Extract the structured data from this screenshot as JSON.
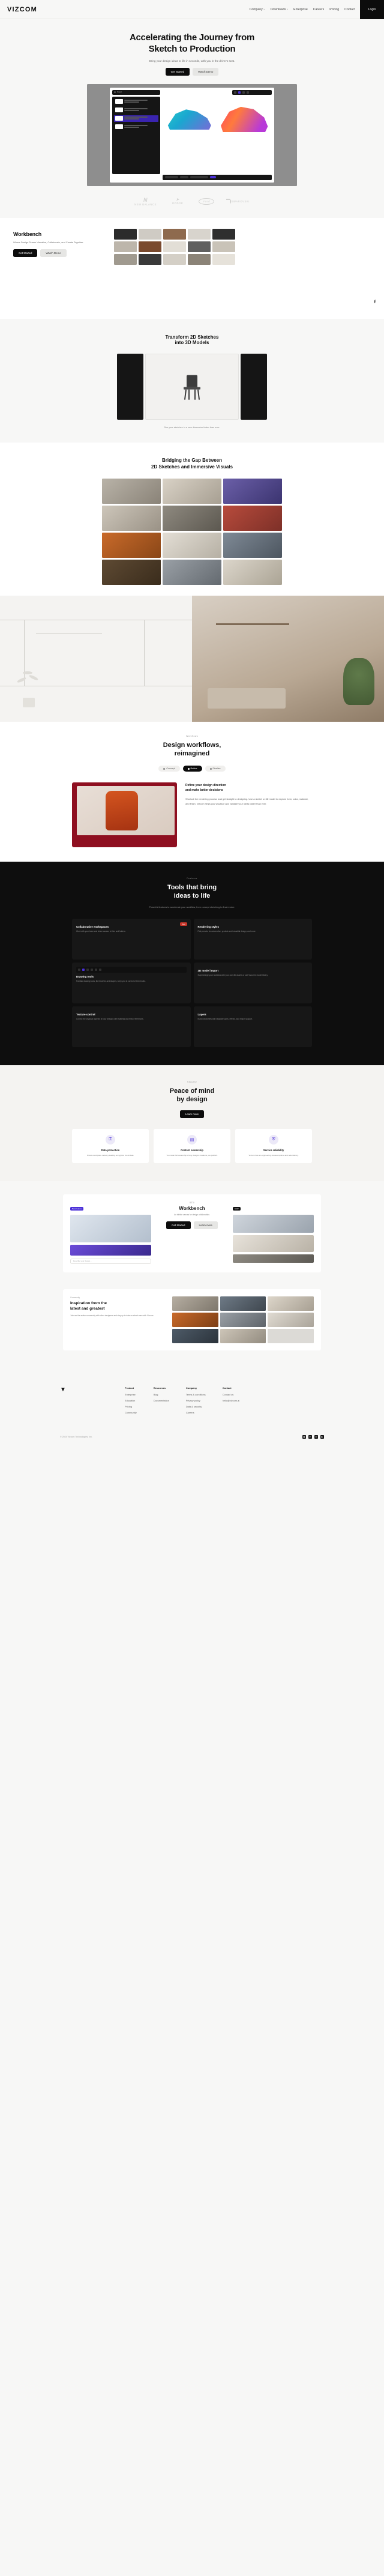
{
  "brand": {
    "name": "VIZCOM"
  },
  "header": {
    "nav": [
      {
        "label": "Company",
        "caret": "˅"
      },
      {
        "label": "Downloads",
        "caret": "˅"
      },
      {
        "label": "Enterprise",
        "caret": ""
      },
      {
        "label": "Careers",
        "caret": ""
      },
      {
        "label": "Pricing",
        "caret": ""
      },
      {
        "label": "Contact",
        "caret": ""
      }
    ],
    "login_label": "Login"
  },
  "hero": {
    "title_line1": "Accelerating the Journey from",
    "title_line2": "Sketch to Production",
    "subtitle": "Bring your design ideas to life in seconds, with you in the driver's seat.",
    "primary_cta": "Get Started",
    "secondary_cta": "Watch Demo",
    "app": {
      "topbar_label": "Project",
      "layers_label": "Layers",
      "layers": [
        {
          "title": "Sketch",
          "sub": "Base layer"
        },
        {
          "title": "Color blocking",
          "sub": "Overlay"
        },
        {
          "title": "Render pass",
          "sub": "Selected"
        },
        {
          "title": "Background",
          "sub": "Locked"
        }
      ]
    }
  },
  "logos": [
    {
      "name": "new-balance",
      "glyph": "N",
      "label": "NEW BALANCE"
    },
    {
      "name": "dodge",
      "glyph": "➤",
      "label": "DODGE"
    },
    {
      "name": "ford",
      "glyph": "Ford",
      "label": ""
    },
    {
      "name": "swarovski",
      "glyph": "",
      "label": "SWAROVSKI"
    }
  ],
  "workbench": {
    "title": "Workbench",
    "body": "Where Design Teams Visualize, Collaborate, and Create Together.",
    "primary_cta": "Get Started",
    "secondary_cta": "Watch Demo",
    "social_icon": "facebook-icon"
  },
  "transform3d": {
    "title_line1": "Transform 2D Sketches",
    "title_line2": "into 3D Models",
    "caption": "See your sketches in a new dimension faster than ever."
  },
  "bridge": {
    "title_line1": "Bridging the Gap Between",
    "title_line2": "2D Sketches and Immersive Visuals"
  },
  "workflows": {
    "eyebrow": "Workflows",
    "title_line1": "Design workflows,",
    "title_line2": "reimagined",
    "tabs": [
      {
        "label": "Concept",
        "active": false
      },
      {
        "label": "Refine",
        "active": true
      },
      {
        "label": "Finalize",
        "active": false
      }
    ],
    "card_title_line1": "Refine your design direction",
    "card_title_line2": "and make better decisions",
    "card_body": "Shortcut the rendering process and get straight to designing. Use a sketch or 3D model to explore form, color, material, and finish. Vizcom helps you visualize and validate your ideas faster than ever."
  },
  "tools": {
    "eyebrow": "Features",
    "title_line1": "Tools that bring",
    "title_line2": "ideas to life",
    "subtitle": "Powerful features to accelerate your workflow, from concept sketching to final render.",
    "cards": [
      {
        "name": "collaborative-workspaces",
        "title": "Collaborative workspaces",
        "body": "Work with your team and share access to files and folders.",
        "badge": "New",
        "art": "purple"
      },
      {
        "name": "rendering-styles",
        "title": "Rendering styles",
        "body": "Pick presets for automotive, product and industrial design, and more.",
        "badge": "",
        "art": "grey"
      },
      {
        "name": "drawing-tools",
        "title": "Drawing tools",
        "body": "Familiar drawing tools, like brushes and shapes, keep you in control of the results.",
        "badge": "",
        "art": "tools"
      },
      {
        "name": "3d-model-import",
        "title": "3D model import",
        "body": "Supercharge your workflow with your own 3D assets or use Vizcom's model library.",
        "badge": "",
        "art": "carblue"
      },
      {
        "name": "texture-control",
        "title": "Texture control",
        "body": "Control the physical aspects of your designs with material and finish references.",
        "badge": "",
        "art": "skin"
      },
      {
        "name": "layers",
        "title": "Layers",
        "body": "Build robust files with separate parts, effects, and region support.",
        "badge": "",
        "art": "purple"
      }
    ]
  },
  "peace": {
    "eyebrow": "Security",
    "title_line1": "Peace of mind",
    "title_line2": "by design",
    "subtitle": "Vizcom's cloud-native infrastructure is built with security in mind, giving you the freedom to create without worry.",
    "cta": "Learn more",
    "cards": [
      {
        "icon": "lock-icon",
        "glyph": "⚿",
        "title": "Data protection",
        "body": "Private workplace industry-leading encryption for all data."
      },
      {
        "icon": "document-icon",
        "glyph": "▤",
        "title": "Content ownership",
        "body": "You retain full ownership of any designs creations you publish."
      },
      {
        "icon": "shield-icon",
        "glyph": "⛨",
        "title": "Service reliability",
        "body": "Vizcom has an engineering-focused uptime and redundancy."
      }
    ]
  },
  "promo": {
    "tag": "Workbench",
    "title": "Workbench",
    "body": "An infinite canvas for design collaboration.",
    "primary_cta": "Get Started",
    "secondary_cta": "Learn more",
    "chip_a": "BETA",
    "chip_b": "Beta Feature",
    "chip_c": "NEW",
    "input_placeholder": "Describe your design..."
  },
  "inspiration": {
    "tag": "Community",
    "title_line1": "Inspiration from the",
    "title_line2": "latest and greatest",
    "body": "Join our the active community with other designers and stay up to date on what's new with Vizcom."
  },
  "footer": {
    "logo_glyph": "▼",
    "columns": [
      {
        "heading": "Product",
        "links": [
          "Enterprise",
          "Education",
          "Pricing",
          "Community"
        ]
      },
      {
        "heading": "Resources",
        "links": [
          "Blog",
          "Documentation"
        ]
      },
      {
        "heading": "Company",
        "links": [
          "Terms & conditions",
          "Privacy policy",
          "Data & security",
          "Careers"
        ]
      },
      {
        "heading": "Contact",
        "links": [
          "Contact us",
          "hello@vizcom.ai"
        ]
      }
    ],
    "copyright": "© 2024 Vizcom Technologies, Inc.",
    "social": [
      {
        "name": "instagram-icon",
        "glyph": "▣"
      },
      {
        "name": "linkedin-icon",
        "glyph": "in"
      },
      {
        "name": "twitter-icon",
        "glyph": "✉"
      },
      {
        "name": "youtube-icon",
        "glyph": "▶"
      }
    ]
  }
}
